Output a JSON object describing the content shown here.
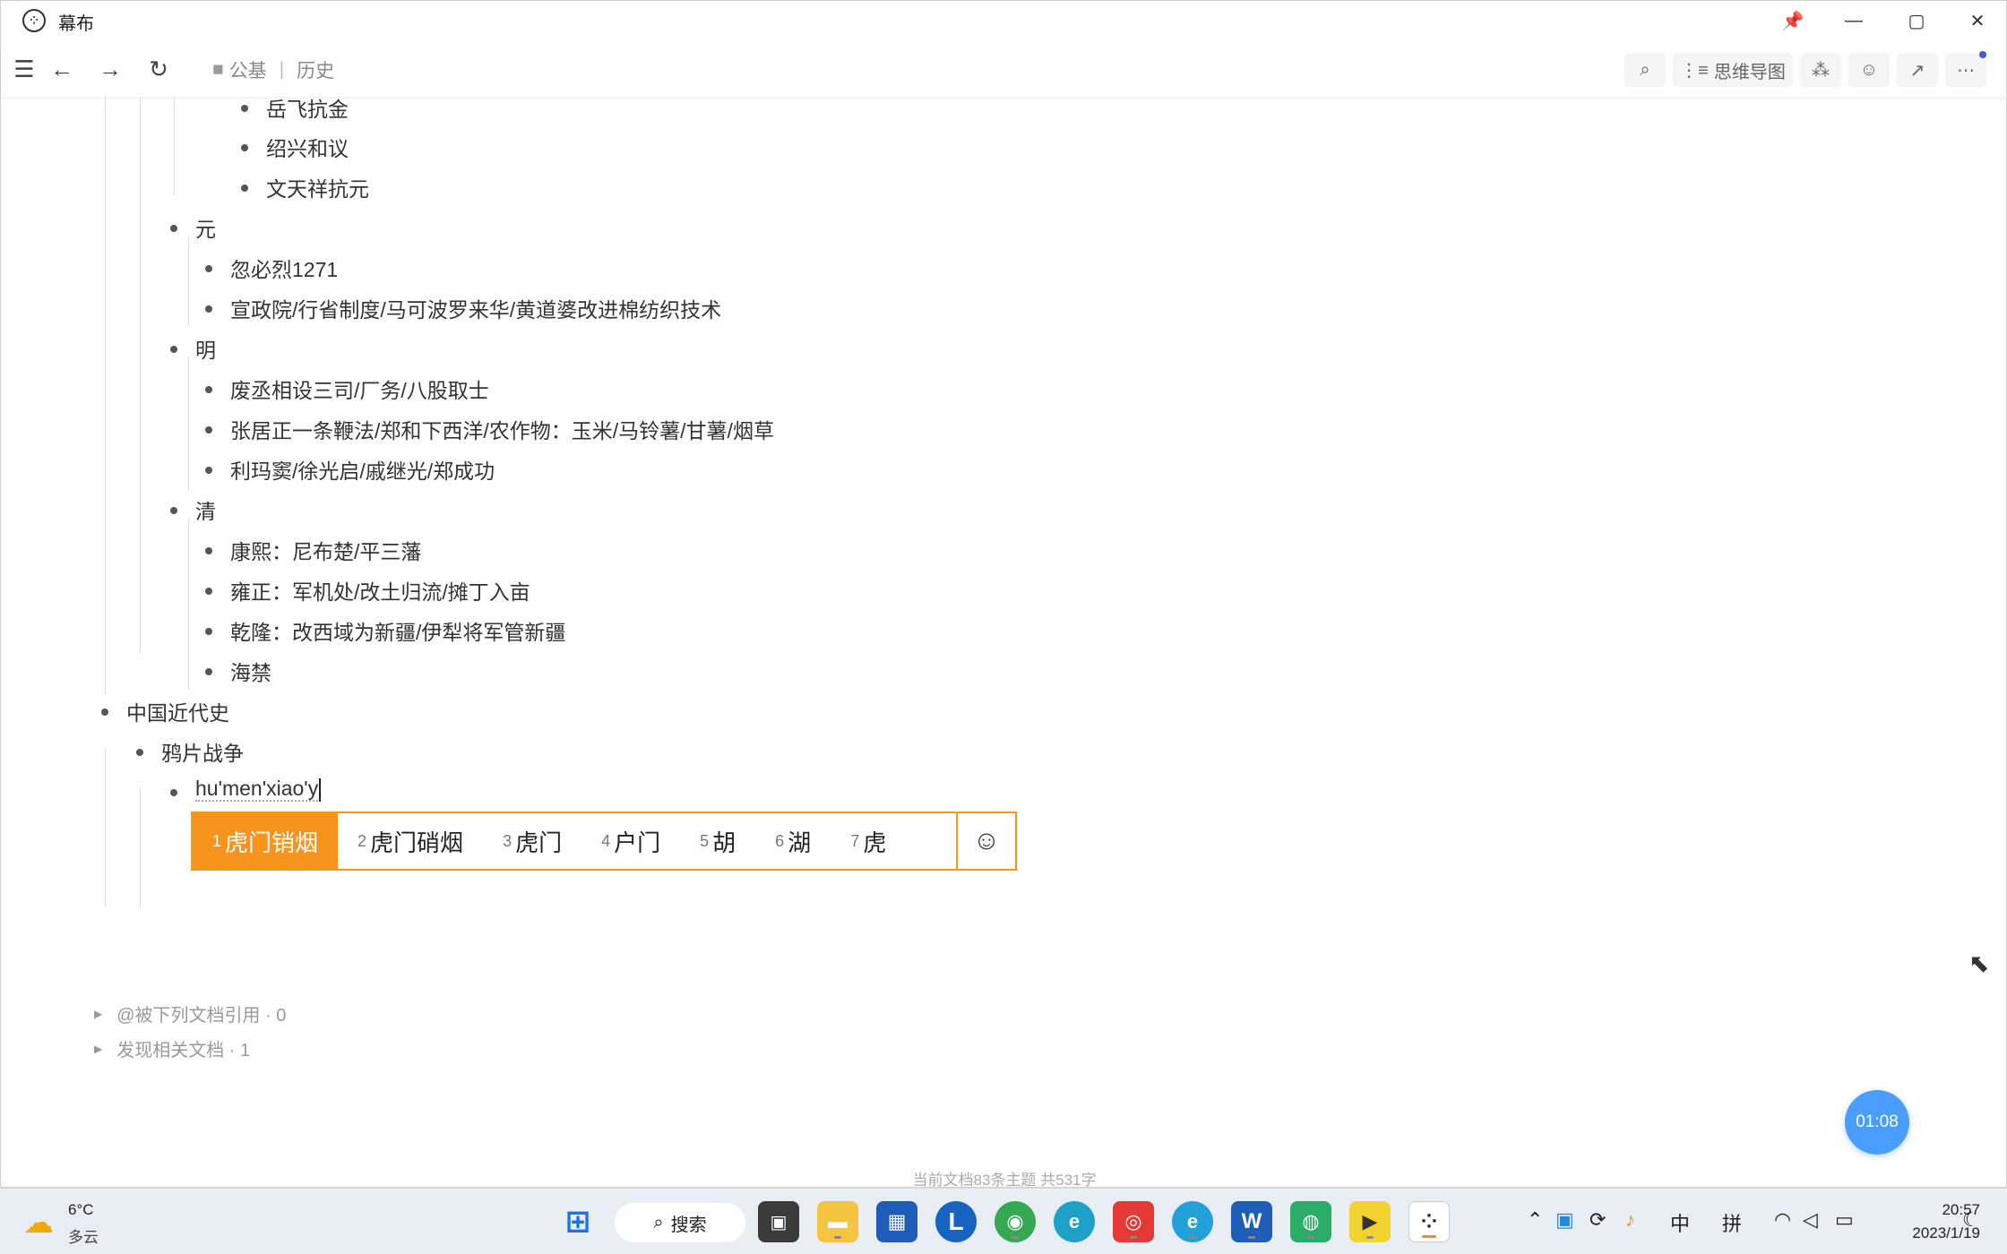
{
  "window": {
    "title": "幕布"
  },
  "toolbar": {
    "breadcrumb_folder": "公基",
    "breadcrumb_current": "历史",
    "mindmap_label": "思维导图"
  },
  "outline": {
    "song_items": [
      "岳飞抗金",
      "绍兴和议",
      "文天祥抗元"
    ],
    "yuan": {
      "title": "元",
      "items": [
        "忽必烈1271",
        "宣政院/行省制度/马可波罗来华/黄道婆改进棉纺织技术"
      ]
    },
    "ming": {
      "title": "明",
      "items": [
        "废丞相设三司/厂务/八股取士",
        "张居正一条鞭法/郑和下西洋/农作物：玉米/马铃薯/甘薯/烟草",
        "利玛窦/徐光启/戚继光/郑成功"
      ]
    },
    "qing": {
      "title": "清",
      "items": [
        "康熙：尼布楚/平三藩",
        "雍正：军机处/改土归流/摊丁入亩",
        "乾隆：改西域为新疆/伊犁将军管新疆",
        "海禁"
      ]
    },
    "modern": {
      "title": "中国近代史",
      "opium_war": "鸦片战争",
      "editing_text": "hu'men'xiao'y"
    }
  },
  "ime": {
    "candidates": [
      {
        "num": "1",
        "text": "虎门销烟"
      },
      {
        "num": "2",
        "text": "虎门硝烟"
      },
      {
        "num": "3",
        "text": "虎门"
      },
      {
        "num": "4",
        "text": "户门"
      },
      {
        "num": "5",
        "text": "胡"
      },
      {
        "num": "6",
        "text": "湖"
      },
      {
        "num": "7",
        "text": "虎"
      }
    ],
    "emoji_icon": "smiley-icon"
  },
  "footer": {
    "backlinks": "@被下列文档引用 · 0",
    "related": "发现相关文档 · 1",
    "status": "当前文档83条主题 共531字"
  },
  "timer": "01:08",
  "taskbar": {
    "weather_temp": "6°C",
    "weather_desc": "多云",
    "search_label": "搜索",
    "ime_mode": "中",
    "ime_pinyin": "拼",
    "time": "20:57",
    "date": "2023/1/19"
  },
  "colors": {
    "ime_accent": "#f7941d",
    "timer_bg": "#4a9eff",
    "taskbar_bg": "#e9eef5"
  }
}
